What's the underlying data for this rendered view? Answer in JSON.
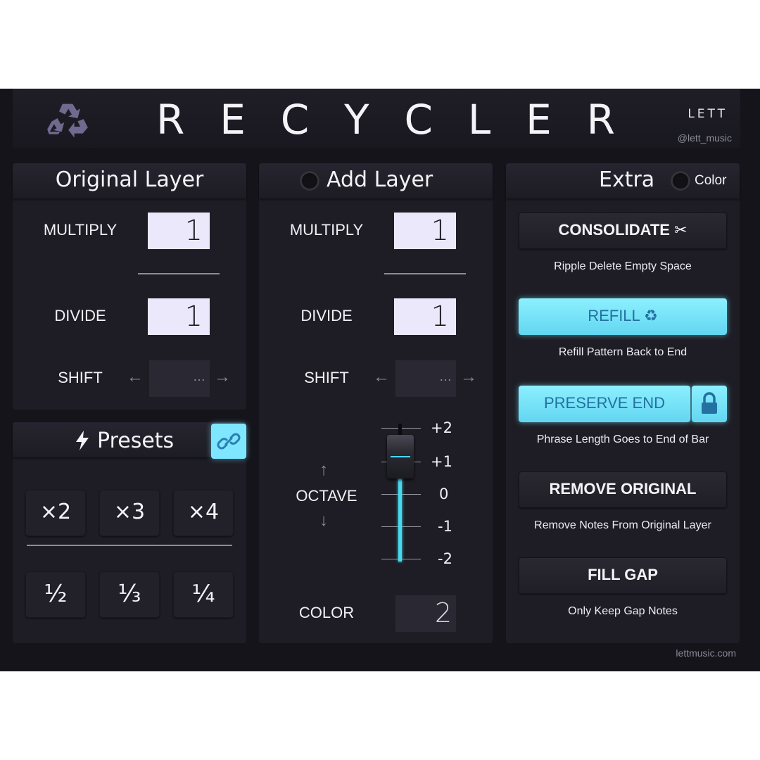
{
  "header": {
    "title_letters": [
      "R",
      "E",
      "C",
      "Y",
      "C",
      "L",
      "E",
      "R"
    ],
    "brand": "LETT",
    "handle": "@lett_music",
    "logo_icon": "recycle-icon"
  },
  "original_layer": {
    "title": "Original Layer",
    "multiply_label": "MULTIPLY",
    "multiply_value": "1",
    "divide_label": "DIVIDE",
    "divide_value": "1",
    "shift_label": "SHIFT",
    "shift_value": "…",
    "shift_left": "←",
    "shift_right": "→"
  },
  "presets": {
    "title": "Presets",
    "icon": "lightning-icon",
    "link_icon": "link-icon",
    "multiply_buttons": [
      "×2",
      "×3",
      "×4"
    ],
    "divide_buttons": [
      "½",
      "⅓",
      "¼"
    ]
  },
  "add_layer": {
    "title": "Add Layer",
    "multiply_label": "MULTIPLY",
    "multiply_value": "1",
    "divide_label": "DIVIDE",
    "divide_value": "1",
    "shift_label": "SHIFT",
    "shift_value": "…",
    "shift_left": "←",
    "shift_right": "→",
    "octave_label": "OCTAVE",
    "octave_up": "↑",
    "octave_down": "↓",
    "octave_ticks": [
      "+2",
      "+1",
      "0",
      "-1",
      "-2"
    ],
    "octave_value": "+1",
    "color_label": "COLOR",
    "color_value": "2"
  },
  "extra": {
    "title": "Extra",
    "color_toggle_label": "Color",
    "consolidate": {
      "label": "CONSOLIDATE ✂",
      "desc": "Ripple Delete Empty Space"
    },
    "refill": {
      "label": "REFILL ♻",
      "desc": "Refill Pattern Back to End"
    },
    "preserve_end": {
      "label": "PRESERVE END",
      "desc": "Phrase Length Goes to End of Bar",
      "lock_icon": "lock-icon"
    },
    "remove_original": {
      "label": "REMOVE ORIGINAL",
      "desc": "Remove Notes From Original Layer"
    },
    "fill_gap": {
      "label": "FILL GAP",
      "desc": "Only Keep Gap Notes"
    }
  },
  "footer": {
    "site": "lettmusic.com"
  },
  "colors": {
    "accent": "#7fe6ff",
    "background": "#15141b",
    "panel": "#1e1d25",
    "input": "#ece8fb"
  }
}
